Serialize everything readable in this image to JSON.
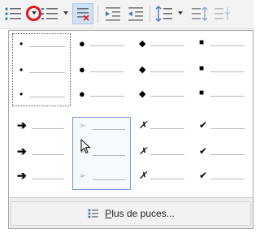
{
  "toolbar": {
    "buttons": [
      {
        "name": "bullets-icon"
      },
      {
        "name": "bullets-dropdown-icon"
      },
      {
        "name": "numbering-icon"
      },
      {
        "name": "numbering-dropdown-icon"
      },
      {
        "name": "clear-list-icon"
      },
      {
        "name": "increase-indent-icon"
      },
      {
        "name": "decrease-indent-icon"
      },
      {
        "name": "line-spacing-icon"
      },
      {
        "name": "line-spacing-dropdown-icon"
      },
      {
        "name": "paragraph-spacing-increase-icon"
      },
      {
        "name": "paragraph-spacing-decrease-icon"
      }
    ],
    "highlight_color": "#e3141a"
  },
  "bullet_menu": {
    "styles": [
      {
        "row": 0,
        "col": 0,
        "symbol": "•",
        "kind": "small-dot",
        "selected": true
      },
      {
        "row": 0,
        "col": 1,
        "symbol": "●",
        "kind": "large-dot"
      },
      {
        "row": 0,
        "col": 2,
        "symbol": "◆",
        "kind": "diamond"
      },
      {
        "row": 0,
        "col": 3,
        "symbol": "■",
        "kind": "square"
      },
      {
        "row": 1,
        "col": 0,
        "symbol": "➔",
        "kind": "arrow"
      },
      {
        "row": 1,
        "col": 1,
        "symbol": "➢",
        "kind": "arrowhead",
        "hovered": true
      },
      {
        "row": 1,
        "col": 2,
        "symbol": "✗",
        "kind": "cross"
      },
      {
        "row": 1,
        "col": 3,
        "symbol": "✔",
        "kind": "check"
      }
    ],
    "more_button": {
      "underlined": "P",
      "rest": "lus de puces..."
    }
  },
  "colors": {
    "selected_border": "#555555",
    "hover_border": "#6e9bd4",
    "icon_blue": "#3a78c8"
  }
}
